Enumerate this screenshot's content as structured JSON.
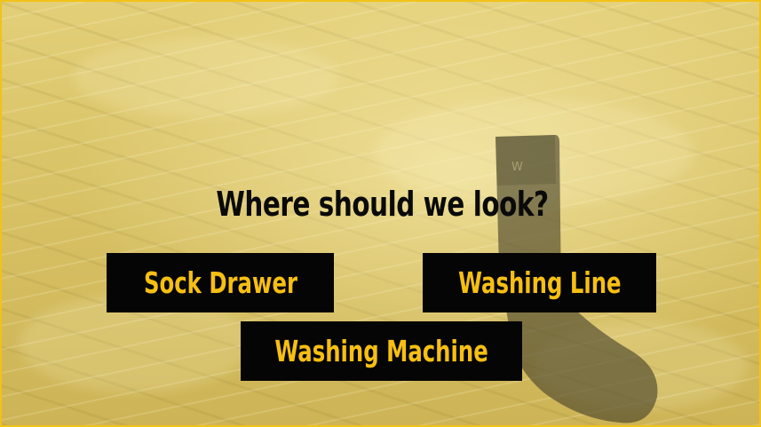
{
  "prompt": {
    "question": "Where should we look?"
  },
  "choices": [
    {
      "label": "Sock Drawer"
    },
    {
      "label": "Washing Line"
    },
    {
      "label": "Washing Machine"
    }
  ],
  "colors": {
    "frame_border": "#f2c218",
    "button_background": "#050505",
    "button_text": "#f7bf12",
    "question_text": "#0a0a0a",
    "sheet_tint": "#d9c46a"
  }
}
